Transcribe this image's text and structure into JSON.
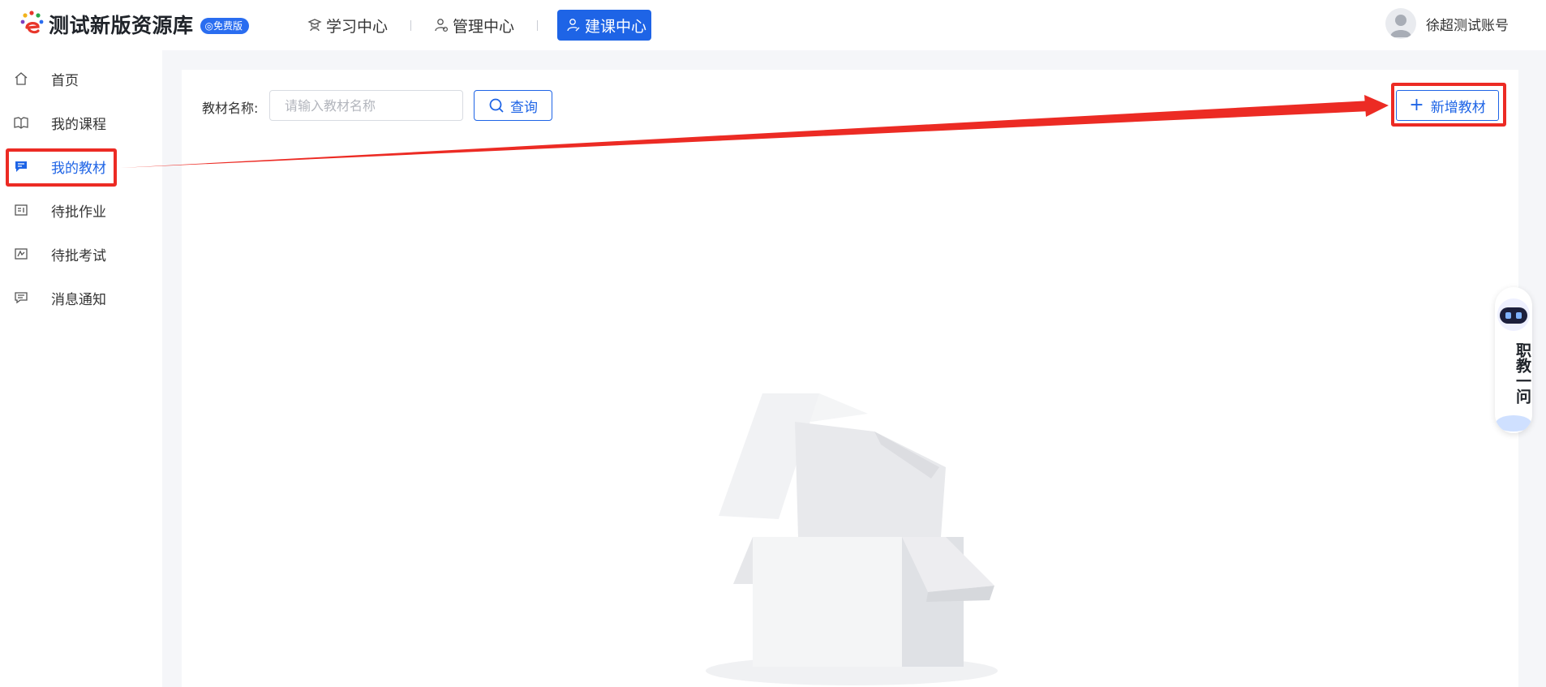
{
  "header": {
    "app_title": "测试新版资源库",
    "badge": "免费版",
    "nav": [
      {
        "label": "学习中心",
        "icon": "graduate-icon"
      },
      {
        "label": "管理中心",
        "icon": "manager-icon"
      },
      {
        "label": "建课中心",
        "icon": "teacher-icon",
        "active": true
      }
    ],
    "user_name": "徐超测试账号"
  },
  "sidebar": {
    "items": [
      {
        "label": "首页",
        "icon": "home-icon"
      },
      {
        "label": "我的课程",
        "icon": "book-icon"
      },
      {
        "label": "我的教材",
        "icon": "textbook-chat-icon",
        "active": true
      },
      {
        "label": "待批作业",
        "icon": "homework-icon"
      },
      {
        "label": "待批考试",
        "icon": "exam-icon"
      },
      {
        "label": "消息通知",
        "icon": "message-icon"
      }
    ]
  },
  "main": {
    "filter_label": "教材名称:",
    "filter_placeholder": "请输入教材名称",
    "filter_value": "",
    "query_label": "查询",
    "add_label": "新增教材"
  },
  "assistant": {
    "label": "职教一问"
  },
  "colors": {
    "primary": "#1e64e6",
    "annotation_red": "#ec2b24",
    "page_bg": "#f5f6f9"
  }
}
